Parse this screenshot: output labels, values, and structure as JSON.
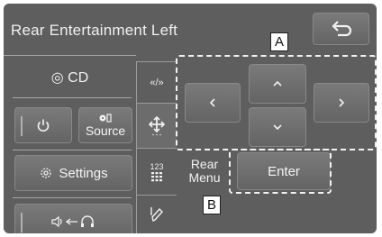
{
  "header": {
    "title": "Rear Entertainment Left"
  },
  "left_panel": {
    "cd_label": "◎ CD",
    "source_label": "Source",
    "settings_label": "Settings"
  },
  "side_bar": {
    "tabs": [
      {
        "label": "«/»"
      },
      {
        "label": "123"
      }
    ]
  },
  "remote": {
    "rear_menu_label": "Rear\nMenu",
    "enter_label": "Enter"
  },
  "callouts": {
    "a": "A",
    "b": "B"
  }
}
